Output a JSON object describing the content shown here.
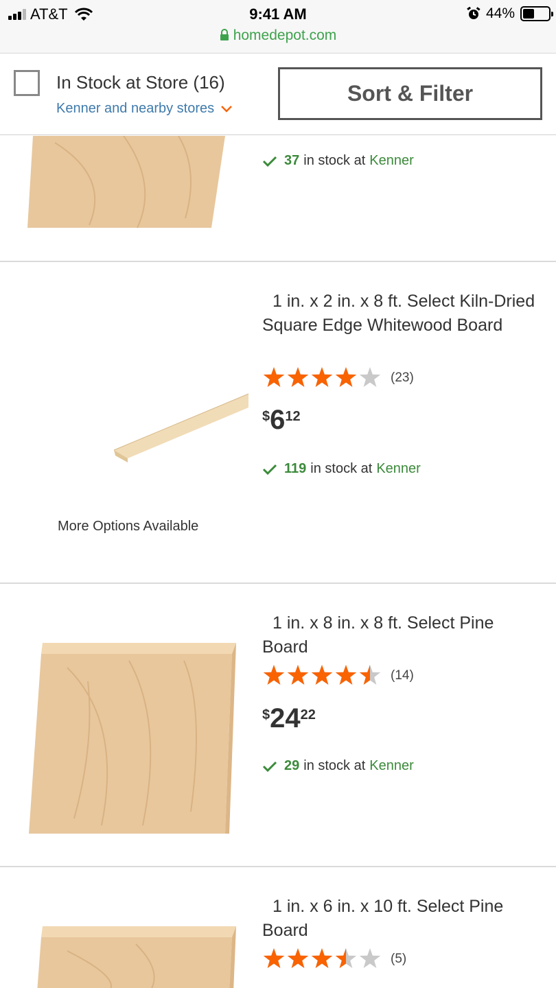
{
  "status_bar": {
    "carrier": "AT&T",
    "time": "9:41 AM",
    "battery": "44%",
    "battery_level": 0.44,
    "url": "homedepot.com"
  },
  "filter": {
    "in_stock_label": "In Stock at Store (16)",
    "store_link": "Kenner and nearby stores",
    "sort_button": "Sort & Filter"
  },
  "colors": {
    "accent_orange": "#f96302",
    "stock_green": "#3b8a3a",
    "link_blue": "#3e7aab"
  },
  "products": [
    {
      "stock_qty": "37",
      "stock_text": "in stock at",
      "stock_store": "Kenner"
    },
    {
      "title": "1 in. x 2 in. x 8 ft. Select Kiln-Dried Square Edge Whitewood Board",
      "rating": 4,
      "review_count": "(23)",
      "price_currency": "$",
      "price_dollars": "6",
      "price_cents": "12",
      "stock_qty": "119",
      "stock_text": "in stock at",
      "stock_store": "Kenner",
      "more_options": "More Options Available"
    },
    {
      "title": "1 in. x 8 in. x 8 ft. Select Pine Board",
      "rating": 4.5,
      "review_count": "(14)",
      "price_currency": "$",
      "price_dollars": "24",
      "price_cents": "22",
      "stock_qty": "29",
      "stock_text": "in stock at",
      "stock_store": "Kenner"
    },
    {
      "title": "1 in. x 6 in. x 10 ft. Select Pine Board",
      "rating": 3.5,
      "review_count": "(5)"
    }
  ]
}
